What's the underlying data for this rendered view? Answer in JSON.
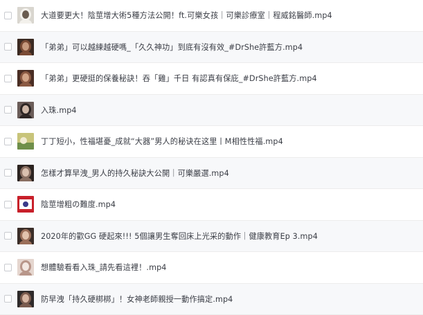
{
  "files": [
    {
      "name": "大道要更大！陰莖增大術5種方法公開！ft.可樂女孩｜可樂診療室｜程威銘醫師.mp4",
      "thumbnail": "video-thumbnail-man-in-white-coat-icon",
      "thumb_colors": [
        "#d9d6cf",
        "#6a5c50",
        "#f3f1ec"
      ]
    },
    {
      "name": "「弟弟」可以越練越硬嗎_「久久神功」到底有沒有效_#DrShe許藍方.mp4",
      "thumbnail": "video-thumbnail-woman-portrait-icon",
      "thumb_colors": [
        "#3b2a22",
        "#c79a7e",
        "#7a4b35"
      ]
    },
    {
      "name": "「弟弟」更硬挺的保養秘訣！吞「雞」千日 有認真有保庇_#DrShe許藍方.mp4",
      "thumbnail": "video-thumbnail-woman-portrait-icon",
      "thumb_colors": [
        "#4a2e24",
        "#d2a588",
        "#8b5a43"
      ]
    },
    {
      "name": "入珠.mp4",
      "thumbnail": "video-thumbnail-woman-portrait-icon",
      "thumb_colors": [
        "#6b5d59",
        "#cfb8a8",
        "#2e2624"
      ]
    },
    {
      "name": "丁丁短小，性福堪憂_成就“大器”男人的秘诀在这里丨M相性性福.mp4",
      "thumbnail": "video-thumbnail-cartoon-icon",
      "thumb_colors": [
        "#c8c47a",
        "#6f8f4a",
        "#f0ead0"
      ]
    },
    {
      "name": "怎樣才算早洩_男人的持久秘訣大公開｜可樂嚴選.mp4",
      "thumbnail": "video-thumbnail-woman-portrait-icon",
      "thumb_colors": [
        "#2b2320",
        "#d9bfae",
        "#8a6f62"
      ]
    },
    {
      "name": "陰莖增粗の難度.mp4",
      "thumbnail": "video-thumbnail-red-graphic-icon",
      "thumb_colors": [
        "#c8202a",
        "#ffffff",
        "#3a3a8a"
      ]
    },
    {
      "name": "2020年的歡GG 硬起來!!! 5個讓男生奪回床上光采的動作｜健康教育Ep 3.mp4",
      "thumbnail": "video-thumbnail-woman-portrait-icon",
      "thumb_colors": [
        "#3a2d28",
        "#e2c2ad",
        "#9b6f5a"
      ]
    },
    {
      "name": "想體驗看看入珠_請先看這裡！.mp4",
      "thumbnail": "video-thumbnail-woman-portrait-icon",
      "thumb_colors": [
        "#e5d6cf",
        "#f3e8e2",
        "#b8968a"
      ]
    },
    {
      "name": "防早洩「持久硬梆梆」！女神老師親授一動作搞定.mp4",
      "thumbnail": "video-thumbnail-woman-portrait-icon",
      "thumb_colors": [
        "#2e2a2a",
        "#d7b6a3",
        "#7a5b4e"
      ]
    }
  ]
}
